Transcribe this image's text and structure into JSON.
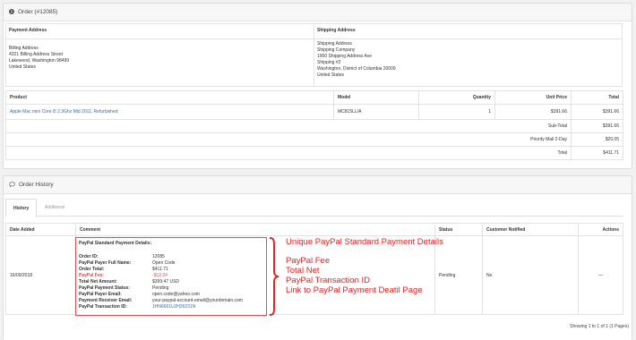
{
  "order_panel": {
    "title": "Order (#12085)",
    "payment_address_label": "Payment Address",
    "shipping_address_label": "Shipping Address",
    "payment_address_lines": [
      "Billing Address",
      "4321 Billing Address Street",
      "Lakewood, Washington 98499",
      "United States"
    ],
    "shipping_address_lines": [
      "Shipping Address",
      "Shipping Company",
      "1900 Shipping Address Ave",
      "Shipping #2",
      "Washington, District of Columbia 20009",
      "United States"
    ],
    "product_headers": [
      "Product",
      "Model",
      "Quantity",
      "Unit Price",
      "Total"
    ],
    "product": {
      "name": "Apple Mac mini Core i5 2.3Ghz Mid 2011, Refurbished",
      "model": "MC815LL/A",
      "quantity": "1",
      "unit_price": "$391.66",
      "total": "$391.66"
    },
    "totals": [
      {
        "label": "Sub-Total",
        "value": "$391.66"
      },
      {
        "label": "Priority Mail 2-Day",
        "value": "$20.05"
      },
      {
        "label": "Total",
        "value": "$411.71"
      }
    ]
  },
  "history_panel": {
    "title": "Order History",
    "tabs": [
      "History",
      "Additional"
    ],
    "headers": [
      "Date Added",
      "Comment",
      "Status",
      "Customer Notified",
      "Actions"
    ],
    "row": {
      "date": "16/09/2018",
      "status": "Pending",
      "notified": "No",
      "actions": "—"
    },
    "comment_title": "PayPal Standard Payment Details:",
    "comment_rows": [
      {
        "k": "Order ID:",
        "v": "12085"
      },
      {
        "k": "PayPal Payer Full Name:",
        "v": "Open Code"
      },
      {
        "k": "Order Total:",
        "v": "$411.71"
      },
      {
        "k": "PayPal Fee:",
        "v": "-$12.24"
      },
      {
        "k": "Total Net Amount:",
        "v": "$399.47 USD"
      },
      {
        "k": "PayPal Payment Status:",
        "v": "Pending"
      },
      {
        "k": "PayPal Payer Email:",
        "v": "open.code@yahoo.com"
      },
      {
        "k": "Payment Receiver Email:",
        "v": "your-paypal-account-email@yourdomain.com"
      },
      {
        "k": "PayPal Transaction ID:",
        "v": "1HN6661UJH26231N"
      }
    ],
    "pagination": "Showing 1 to 1 of 1 (1 Pages)"
  },
  "annotations": {
    "heading": "Unique PayPal Standard Payment Details",
    "items": [
      "PayPal Fee",
      "Total Net",
      "PayPal Transaction ID",
      "Link to PayPal Payment Deatil Page"
    ]
  },
  "colors": {
    "annotation_red": "#e02424",
    "link_blue": "#2a6ebb"
  },
  "icons": {
    "order_heading": "info-circle-icon",
    "history_heading": "comment-icon"
  }
}
